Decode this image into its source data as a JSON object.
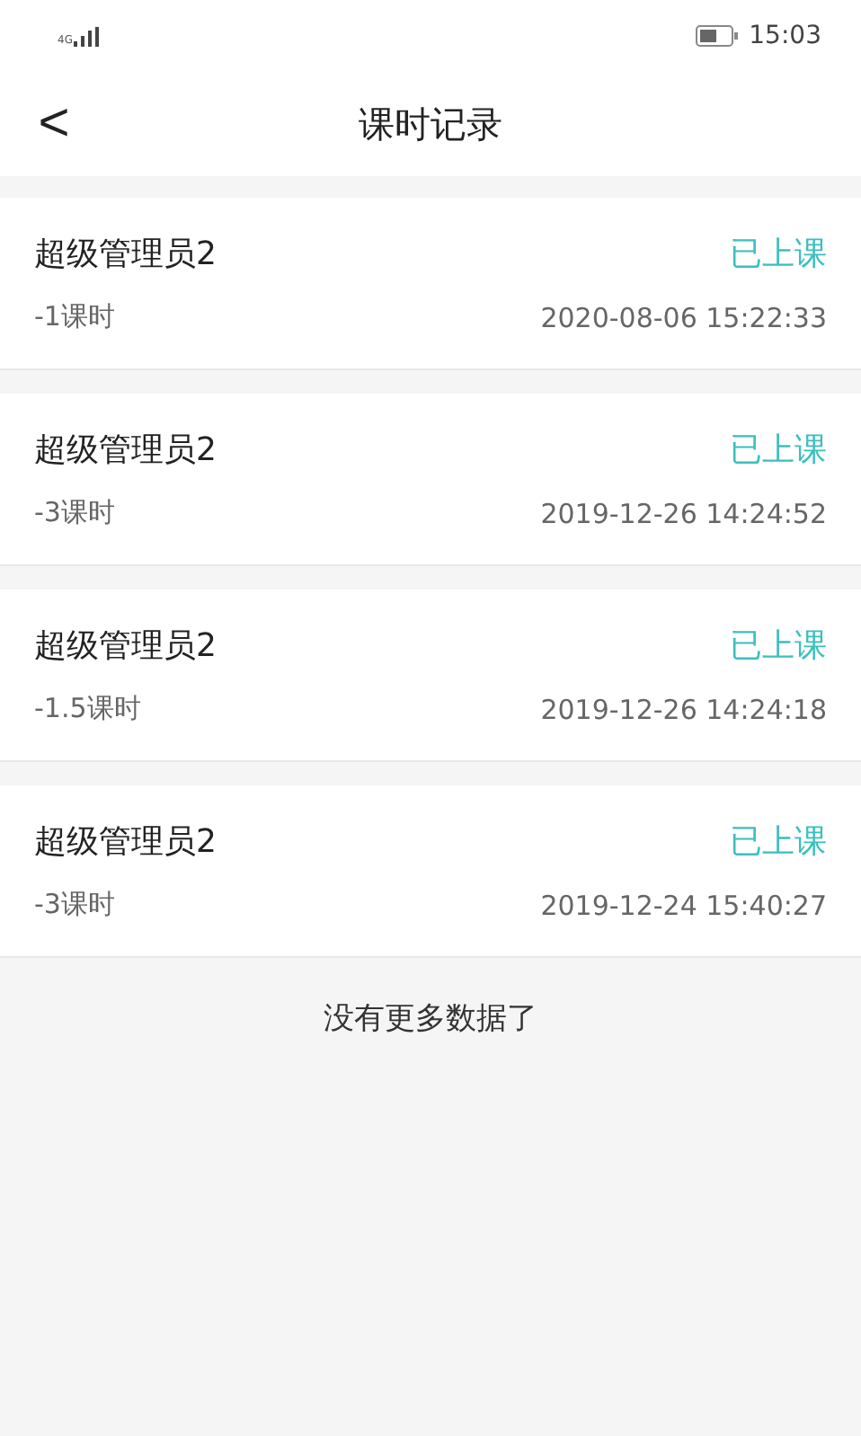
{
  "status_bar": {
    "network": "4G",
    "time": "15:03"
  },
  "header": {
    "back": "<",
    "title": "课时记录"
  },
  "records": [
    {
      "name": "超级管理员2",
      "status": "已上课",
      "hours": "-1课时",
      "time": "2020-08-06 15:22:33"
    },
    {
      "name": "超级管理员2",
      "status": "已上课",
      "hours": "-3课时",
      "time": "2019-12-26 14:24:52"
    },
    {
      "name": "超级管理员2",
      "status": "已上课",
      "hours": "-1.5课时",
      "time": "2019-12-26 14:24:18"
    },
    {
      "name": "超级管理员2",
      "status": "已上课",
      "hours": "-3课时",
      "time": "2019-12-24 15:40:27"
    }
  ],
  "footer": "没有更多数据了"
}
